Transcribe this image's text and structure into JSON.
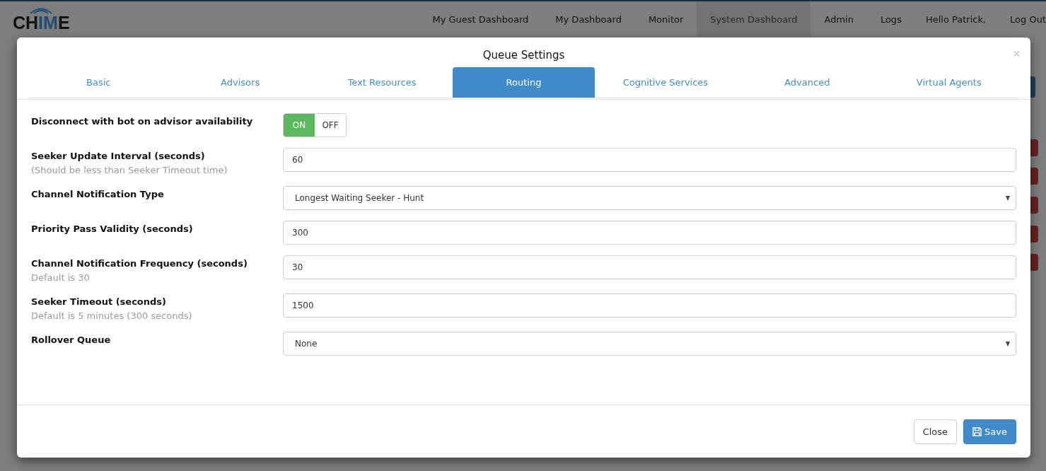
{
  "logo": {
    "parts": [
      {
        "text": "CH",
        "accent": false
      },
      {
        "text": "IM",
        "accent": true
      },
      {
        "text": "E",
        "accent": false
      }
    ]
  },
  "nav": {
    "items": [
      {
        "label": "My Guest Dashboard",
        "selected": false
      },
      {
        "label": "My Dashboard",
        "selected": false
      },
      {
        "label": "Monitor",
        "selected": false
      },
      {
        "label": "System Dashboard",
        "selected": true
      },
      {
        "label": "Admin",
        "selected": false
      },
      {
        "label": "Logs",
        "selected": false
      }
    ],
    "greeting": "Hello Patrick,",
    "logout": "Log Out"
  },
  "modal": {
    "title": "Queue Settings",
    "close": "×",
    "tabs": [
      {
        "label": "Basic",
        "selected": false
      },
      {
        "label": "Advisors",
        "selected": false
      },
      {
        "label": "Text Resources",
        "selected": false
      },
      {
        "label": "Routing",
        "selected": true
      },
      {
        "label": "Cognitive Services",
        "selected": false
      },
      {
        "label": "Advanced",
        "selected": false
      },
      {
        "label": "Virtual Agents",
        "selected": false
      }
    ],
    "fields": [
      {
        "kind": "toggle",
        "label": "Disconnect with bot on advisor availability",
        "options": [
          {
            "label": "ON",
            "selected": true
          },
          {
            "label": "OFF",
            "selected": false
          }
        ]
      },
      {
        "kind": "text",
        "label": "Seeker Update Interval (seconds)",
        "hint": "(Should be less than Seeker Timeout time)",
        "value": "60"
      },
      {
        "kind": "select",
        "label": "Channel Notification Type",
        "value": "Longest Waiting Seeker - Hunt"
      },
      {
        "kind": "text",
        "label": "Priority Pass Validity (seconds)",
        "value": "300"
      },
      {
        "kind": "text",
        "label": "Channel Notification Frequency (seconds)",
        "hint": "Default is 30",
        "value": "30"
      },
      {
        "kind": "text",
        "label": "Seeker Timeout (seconds)",
        "hint": "Default is 5 minutes (300 seconds)",
        "value": "1500"
      },
      {
        "kind": "select",
        "label": "Rollover Queue",
        "value": "None"
      }
    ],
    "buttons": {
      "close": "Close",
      "save": "Save"
    }
  }
}
